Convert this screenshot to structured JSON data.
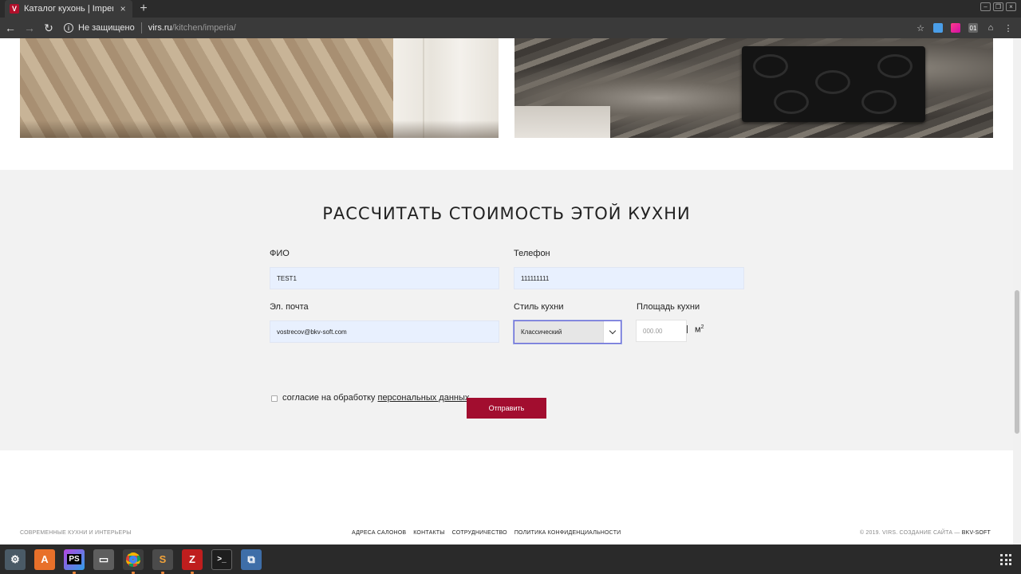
{
  "browser": {
    "tab_title": "Каталог кухонь | Imperia",
    "tab_favicon_letter": "V",
    "tab_close": "×",
    "new_tab": "+",
    "security_label": "Не защищено",
    "url_host": "virs.ru",
    "url_path": "/kitchen/imperia/",
    "ext3_label": "01",
    "accent_color": "#a20d2f"
  },
  "form": {
    "title": "РАССЧИТАТЬ СТОИМОСТЬ ЭТОЙ КУХНИ",
    "fio_label": "ФИО",
    "fio_value": "TEST1",
    "phone_label": "Телефон",
    "phone_value": "111111111",
    "email_label": "Эл. почта",
    "email_value": "vostrecov@bkv-soft.com",
    "style_label": "Стиль кухни",
    "style_value": "Классический",
    "area_label": "Площадь кухни",
    "area_placeholder": "000.00",
    "area_unit": "м",
    "area_unit_sup": "2",
    "consent_text": "согласие на обработку ",
    "consent_link": "персональных данных",
    "submit_label": "Отправить"
  },
  "footer": {
    "tagline": "СОВРЕМЕННЫЕ КУХНИ И ИНТЕРЬЕРЫ",
    "nav": [
      "АДРЕСА САЛОНОВ",
      "КОНТАКТЫ",
      "СОТРУДНИЧЕСТВО",
      "ПОЛИТИКА КОНФИДЕНЦИАЛЬНОСТИ"
    ],
    "copyright": "© 2019. VIRS. СОЗДАНИЕ САЙТА — ",
    "developer": "BKV-SOFT"
  },
  "taskbar": {
    "apps": [
      "settings-app",
      "appstore-app",
      "phpstorm-app",
      "files-app",
      "chrome-app",
      "sublime-app",
      "filezilla-app",
      "terminal-app",
      "network-app"
    ],
    "phpstorm_label": "PS"
  }
}
